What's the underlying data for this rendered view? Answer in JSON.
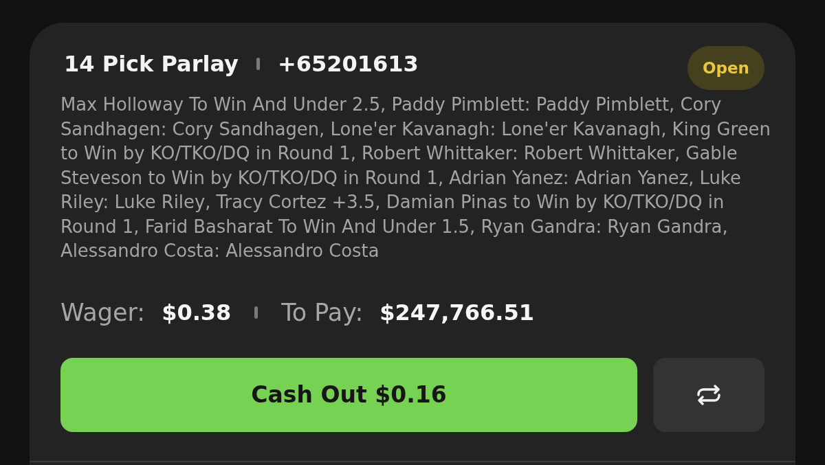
{
  "bet": {
    "title": "14 Pick Parlay",
    "odds": "+65201613",
    "status": {
      "label": "Open",
      "kind": "open"
    },
    "description": "Max Holloway To Win And Under 2.5, Paddy Pimblett: Paddy Pimblett, Cory Sandhagen: Cory Sandhagen, Lone'er Kavanagh: Lone'er Kavanagh, King Green to Win by KO/TKO/DQ in Round 1, Robert Whittaker: Robert Whittaker, Gable Steveson to Win by KO/TKO/DQ in Round 1, Adrian Yanez: Adrian Yanez, Luke Riley: Luke Riley, Tracy Cortez +3.5, Damian Pinas to Win by KO/TKO/DQ in Round 1, Farid Basharat To Win And Under 1.5, Ryan Gandra: Ryan Gandra, Alessandro Costa: Alessandro Costa",
    "wager": {
      "label": "Wager:",
      "value": "$0.38"
    },
    "to_pay": {
      "label": "To Pay:",
      "value": "$247,766.51"
    }
  },
  "actions": {
    "cash_out": "Cash Out $0.16"
  }
}
